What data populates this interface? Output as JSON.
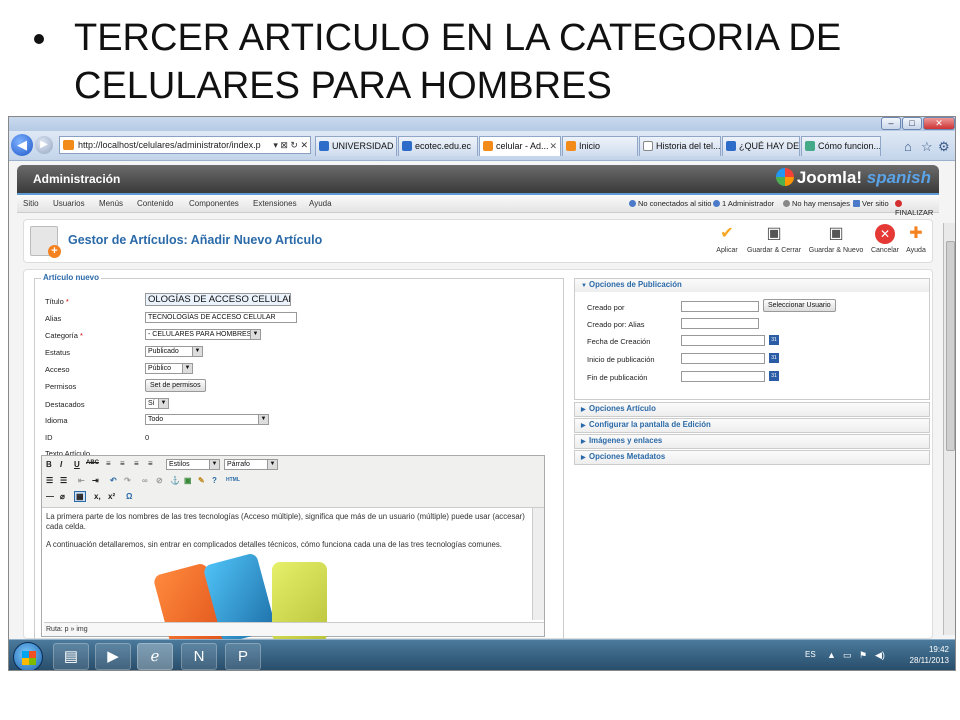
{
  "slide": {
    "title": "TERCER ARTICULO EN LA CATEGORIA DE CELULARES PARA HOMBRES"
  },
  "browser": {
    "url": "http://localhost/celulares/administrator/index.p",
    "url_controls": "▾ ⊠ ↻ ✕",
    "tabs": [
      {
        "label": "UNIVERSIDAD ..."
      },
      {
        "label": "ecotec.edu.ec"
      },
      {
        "label": "celular - Ad..."
      },
      {
        "label": "Inicio"
      },
      {
        "label": "Historia del tel..."
      },
      {
        "label": "¿QUÉ HAY DE..."
      },
      {
        "label": "Cómo funcion..."
      }
    ],
    "window_buttons": {
      "minimize": "–",
      "maximize": "□",
      "close": "✕"
    }
  },
  "joomla": {
    "header_title": "Administración",
    "logo_text": "Joomla!",
    "logo_suffix": "spanish",
    "menu": [
      "Sitio",
      "Usuarios",
      "Menús",
      "Contenido",
      "Componentes",
      "Extensiones",
      "Ayuda"
    ],
    "status": {
      "visitors": "No conectados al sitio",
      "admins": "1 Administrador",
      "messages": "No hay mensajes",
      "view_site": "Ver sitio",
      "logout": "FINALIZAR"
    },
    "page_title": "Gestor de Artículos: Añadir Nuevo Artículo",
    "toolbar": [
      {
        "label": "Aplicar",
        "icon": "✔",
        "color": "#f5a623"
      },
      {
        "label": "Guardar & Cerrar",
        "icon": "▣",
        "color": "#555555"
      },
      {
        "label": "Guardar & Nuevo",
        "icon": "▣",
        "color": "#555555"
      },
      {
        "label": "Cancelar",
        "icon": "✕",
        "color": "#e53935"
      },
      {
        "label": "Ayuda",
        "icon": "✚",
        "color": "#f58220"
      }
    ],
    "form": {
      "legend": "Artículo nuevo",
      "titulo_label": "Título",
      "titulo_value": "OLOGÍAS DE ACCESO CELULAR",
      "alias_label": "Alias",
      "alias_value": "TECNOLOGÍAS DE ACCESO CELULAR",
      "categoria_label": "Categoría",
      "categoria_value": "- CELULARES PARA HOMBRES",
      "estatus_label": "Estatus",
      "estatus_value": "Publicado",
      "acceso_label": "Acceso",
      "acceso_value": "Público",
      "permisos_label": "Permisos",
      "permisos_button": "Set de permisos",
      "destacados_label": "Destacados",
      "destacados_value": "Sí",
      "idioma_label": "Idioma",
      "idioma_value": "Todo",
      "id_label": "ID",
      "id_value": "0",
      "texto_label": "Texto Artículo",
      "required_mark": "*"
    },
    "editor": {
      "estilos": "Estilos",
      "parrafo": "Párrafo",
      "paragraph1": "La primera parte de los nombres de las tres tecnologías (Acceso múltiple), significa que más de un usuario (múltiple) puede usar (accesar) cada celda.",
      "paragraph2": "A continuación detallaremos, sin entrar en complicados detalles técnicos, cómo funciona cada una de las tres tecnologías comunes.",
      "path": "Ruta: p » img"
    },
    "publishing": {
      "header": "Opciones de Publicación",
      "creado_por": "Creado por",
      "select_user": "Seleccionar Usuario",
      "creado_alias": "Creado por: Alias",
      "fecha_creacion": "Fecha de Creación",
      "inicio_pub": "Inicio de publicación",
      "fin_pub": "Fin de publicación",
      "cal": "31"
    },
    "panels": [
      "Opciones Artículo",
      "Configurar la pantalla de Edición",
      "Imágenes y enlaces",
      "Opciones Metadatos"
    ]
  },
  "taskbar": {
    "lang": "ES",
    "time": "19:42",
    "date": "28/11/2013"
  }
}
